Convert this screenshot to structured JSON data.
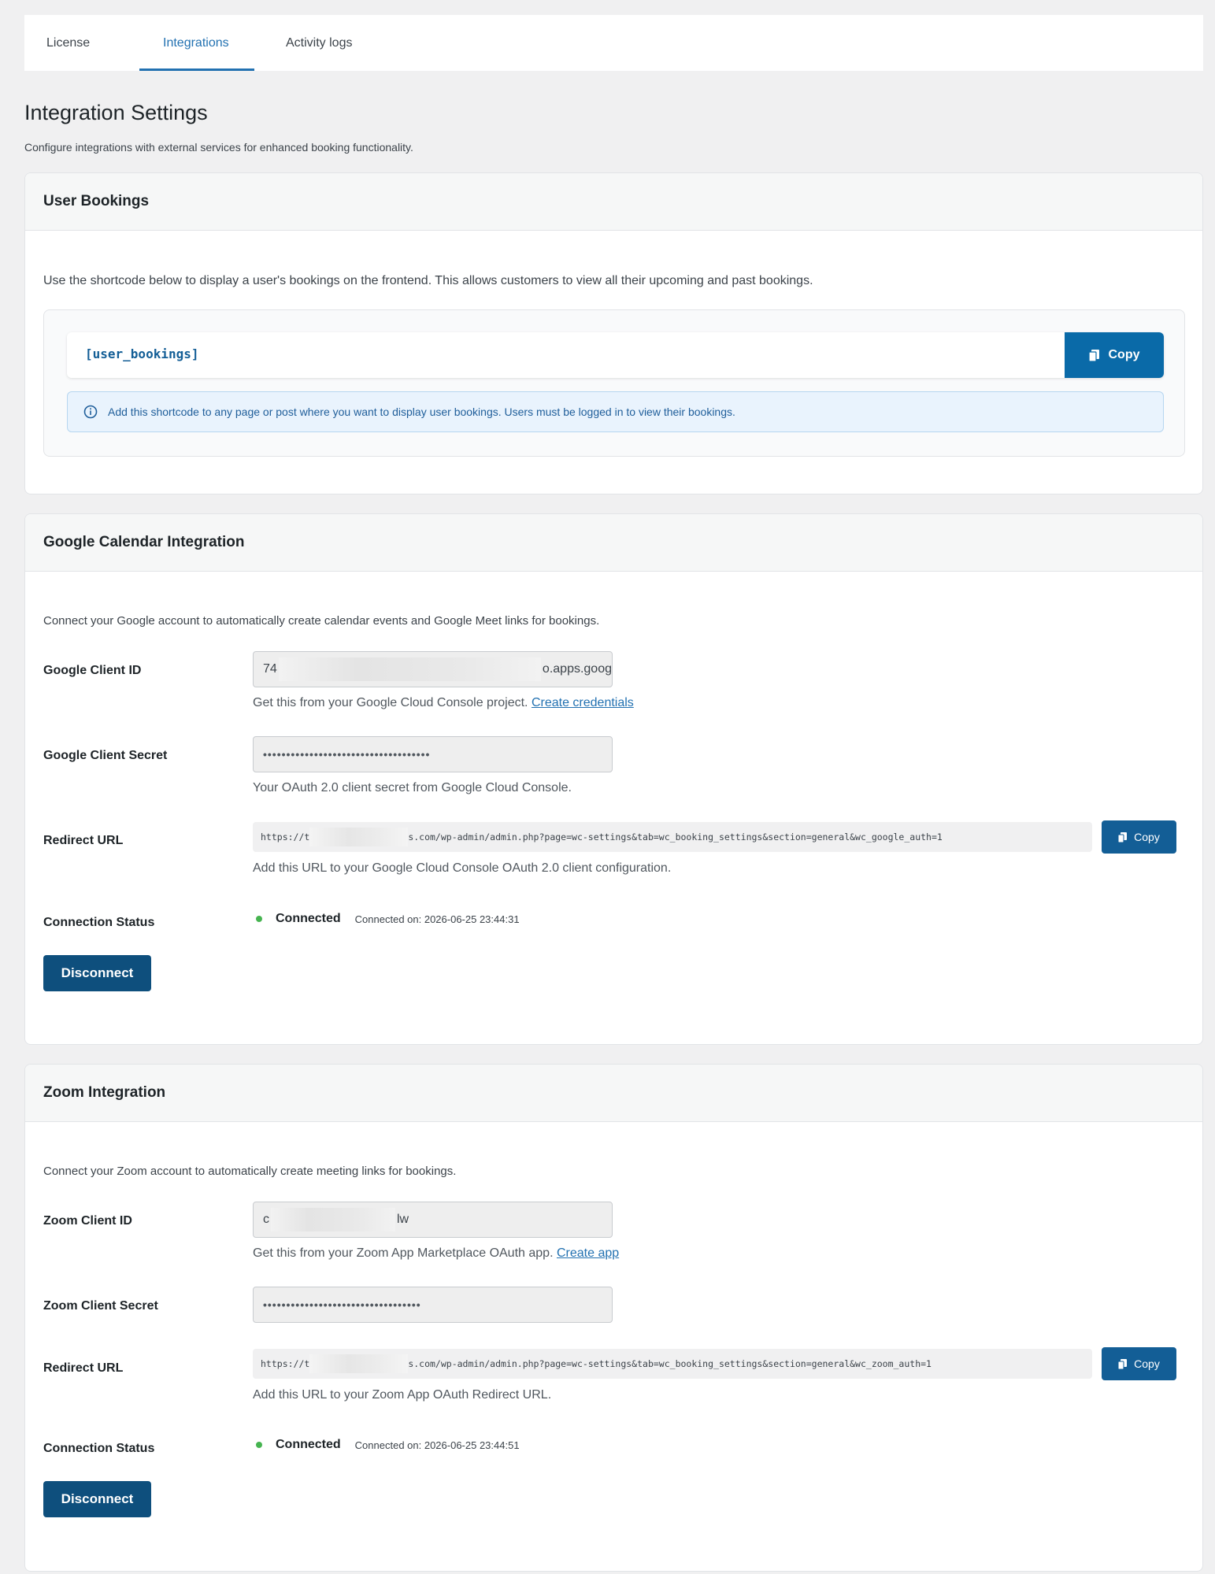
{
  "tabs": [
    {
      "label": "License",
      "active": false
    },
    {
      "label": "Integrations",
      "active": true
    },
    {
      "label": "Activity logs",
      "active": false
    }
  ],
  "page": {
    "title": "Integration Settings",
    "description": "Configure integrations with external services for enhanced booking functionality."
  },
  "user_bookings": {
    "title": "User Bookings",
    "description": "Use the shortcode below to display a user's bookings on the frontend. This allows customers to view all their upcoming and past bookings.",
    "shortcode": "[user_bookings]",
    "copy_label": "Copy",
    "note": "Add this shortcode to any page or post where you want to display user bookings. Users must be logged in to view their bookings."
  },
  "google": {
    "title": "Google Calendar Integration",
    "description": "Connect your Google account to automatically create calendar events and Google Meet links for bookings.",
    "client_id_label": "Google Client ID",
    "client_id_prefix": "74",
    "client_id_suffix": "o.apps.goog",
    "client_id_help": "Get this from your Google Cloud Console project.",
    "client_id_link": "Create credentials",
    "client_secret_label": "Google Client Secret",
    "client_secret_value": "••••••••••••••••••••••••••••••••••••",
    "client_secret_help": "Your OAuth 2.0 client secret from Google Cloud Console.",
    "redirect_label": "Redirect URL",
    "redirect_prefix": "https://t",
    "redirect_suffix": "s.com/wp-admin/admin.php?page=wc-settings&tab=wc_booking_settings&section=general&wc_google_auth=1",
    "redirect_copy": "Copy",
    "redirect_help": "Add this URL to your Google Cloud Console OAuth 2.0 client configuration.",
    "status_label": "Connection Status",
    "status_text": "Connected",
    "status_time": "Connected on: 2026-06-25 23:44:31",
    "disconnect_label": "Disconnect"
  },
  "zoom": {
    "title": "Zoom Integration",
    "description": "Connect your Zoom account to automatically create meeting links for bookings.",
    "client_id_label": "Zoom Client ID",
    "client_id_prefix": "c",
    "client_id_suffix": "lw",
    "client_id_help": "Get this from your Zoom App Marketplace OAuth app.",
    "client_id_link": "Create app",
    "client_secret_label": "Zoom Client Secret",
    "client_secret_value": "••••••••••••••••••••••••••••••••••",
    "redirect_label": "Redirect URL",
    "redirect_prefix": "https://t",
    "redirect_suffix": "s.com/wp-admin/admin.php?page=wc-settings&tab=wc_booking_settings&section=general&wc_zoom_auth=1",
    "redirect_copy": "Copy",
    "redirect_help": "Add this URL to your Zoom App OAuth Redirect URL.",
    "status_label": "Connection Status",
    "status_text": "Connected",
    "status_time": "Connected on: 2026-06-25 23:44:51",
    "disconnect_label": "Disconnect"
  },
  "icons": {
    "copy": "copy-icon",
    "info": "info-icon",
    "status": "status-dot-icon"
  },
  "colors": {
    "accent": "#2271b1",
    "primary_button": "#0e4f7d",
    "copy_button": "#0a6aa8",
    "connected": "#46b450",
    "note_bg": "#e9f3fd"
  }
}
